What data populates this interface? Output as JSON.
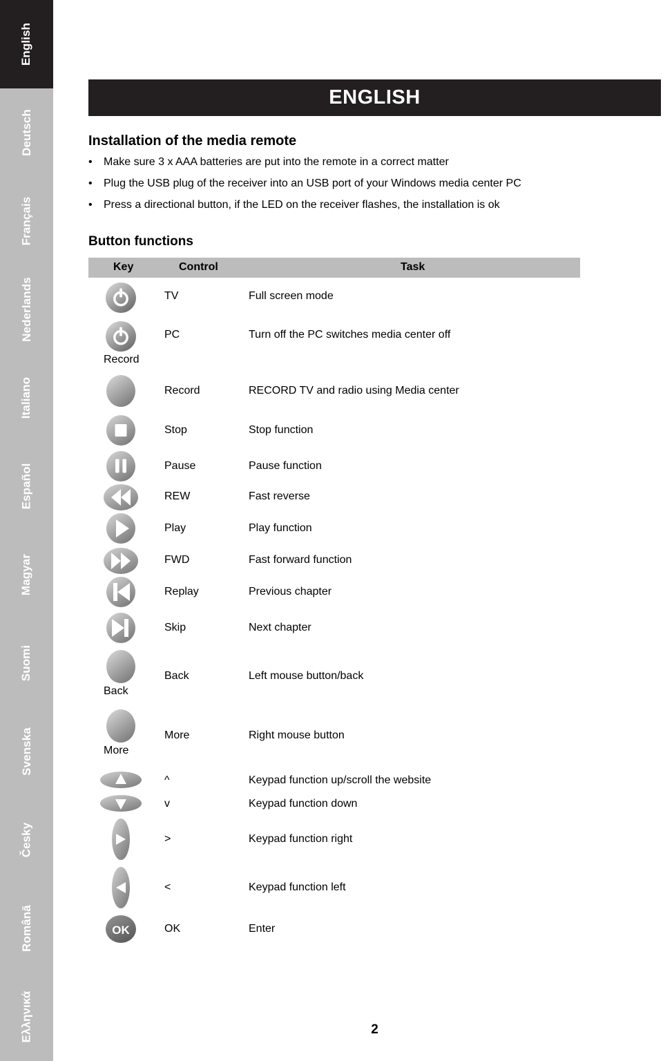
{
  "sidebar": {
    "languages": [
      {
        "label": "English",
        "active": true
      },
      {
        "label": "Deutsch",
        "active": false
      },
      {
        "label": "Français",
        "active": false
      },
      {
        "label": "Nederlands",
        "active": false
      },
      {
        "label": "Italiano",
        "active": false
      },
      {
        "label": "Español",
        "active": false
      },
      {
        "label": "Magyar",
        "active": false
      },
      {
        "label": "Suomi",
        "active": false
      },
      {
        "label": "Svenska",
        "active": false
      },
      {
        "label": "Česky",
        "active": false
      },
      {
        "label": "Română",
        "active": false
      },
      {
        "label": "Ελληνικά",
        "active": false
      }
    ]
  },
  "header": {
    "title": "ENGLISH",
    "background_color": "#231f20",
    "text_color": "#ffffff"
  },
  "install": {
    "heading": "Installation of the media remote",
    "bullet_marker": "•",
    "bullets": [
      "Make sure 3 x AAA batteries are put into the remote in a correct matter",
      "Plug the USB plug of the receiver into an USB port of your Windows media center PC",
      "Press a directional button, if the LED on the receiver flashes, the installation is ok"
    ]
  },
  "button_functions": {
    "heading": "Button functions",
    "table": {
      "header_background": "#bcbcbc",
      "columns": [
        "Key",
        "Control",
        "Task"
      ],
      "rows": [
        {
          "icon": "power-icon",
          "sub_label": "",
          "control": "TV",
          "task": "Full screen mode"
        },
        {
          "icon": "power-icon",
          "sub_label": "Record",
          "control": "PC",
          "task": "Turn off the PC switches media center off"
        },
        {
          "icon": "record-icon",
          "sub_label": "",
          "control": "Record",
          "task": "RECORD TV and radio using Media center"
        },
        {
          "icon": "stop-icon",
          "sub_label": "",
          "control": "Stop",
          "task": "Stop function"
        },
        {
          "icon": "pause-icon",
          "sub_label": "",
          "control": "Pause",
          "task": "Pause function"
        },
        {
          "icon": "rewind-icon",
          "sub_label": "",
          "control": "REW",
          "task": "Fast reverse"
        },
        {
          "icon": "play-icon",
          "sub_label": "",
          "control": "Play",
          "task": "Play function"
        },
        {
          "icon": "fast-forward-icon",
          "sub_label": "",
          "control": "FWD",
          "task": "Fast forward function"
        },
        {
          "icon": "replay-icon",
          "sub_label": "",
          "control": "Replay",
          "task": "Previous chapter"
        },
        {
          "icon": "skip-icon",
          "sub_label": "",
          "control": "Skip",
          "task": "Next chapter"
        },
        {
          "icon": "back-icon",
          "sub_label": "Back",
          "control": "Back",
          "task": "Left mouse button/back"
        },
        {
          "icon": "more-icon",
          "sub_label": "More",
          "control": "More",
          "task": "Right mouse button"
        },
        {
          "icon": "arrow-up-icon",
          "sub_label": "",
          "control": "^",
          "task": "Keypad function up/scroll the website"
        },
        {
          "icon": "arrow-down-icon",
          "sub_label": "",
          "control": "v",
          "task": "Keypad function down"
        },
        {
          "icon": "arrow-right-icon",
          "sub_label": "",
          "control": ">",
          "task": "Keypad function right"
        },
        {
          "icon": "arrow-left-icon",
          "sub_label": "",
          "control": "<",
          "task": "Keypad function left"
        },
        {
          "icon": "ok-icon",
          "sub_label": "",
          "control": "OK",
          "task": "Enter"
        }
      ]
    }
  },
  "footer": {
    "page_number": "2"
  }
}
